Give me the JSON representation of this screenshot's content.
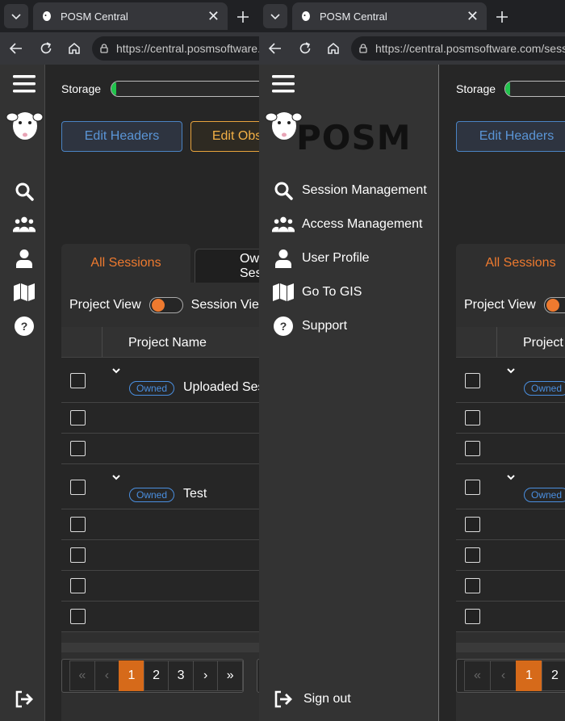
{
  "browser": {
    "tab_title": "POSM Central",
    "url": "https://central.posmsoftware.com/sessions"
  },
  "app": {
    "logo_text": "POSM",
    "storage_label": "Storage",
    "storage_fraction": 0.02,
    "buttons": {
      "edit_headers": "Edit Headers",
      "edit_observations": "Edit Observations"
    },
    "tabs": {
      "all_sessions": "All Sessions",
      "owned": "Owned Sessions"
    },
    "view": {
      "project_view": "Project View",
      "session_view": "Session View"
    },
    "table": {
      "header_project_name": "Project Name",
      "badge_owned": "Owned",
      "groups": [
        {
          "name": "Uploaded Sessions"
        },
        {
          "name": "Test"
        }
      ]
    },
    "pagination": {
      "first": "«",
      "prev": "‹",
      "pages": [
        "1",
        "2",
        "3"
      ],
      "next": "›",
      "last": "»",
      "active_page": "1"
    },
    "menu": {
      "session_management": "Session Management",
      "access_management": "Access Management",
      "user_profile": "User Profile",
      "go_to_gis": "Go To GIS",
      "support": "Support",
      "sign_out": "Sign out"
    }
  },
  "colors": {
    "accent_orange": "#ee7a2f",
    "accent_blue": "#4a83c4",
    "storage_green": "#21c44c"
  }
}
